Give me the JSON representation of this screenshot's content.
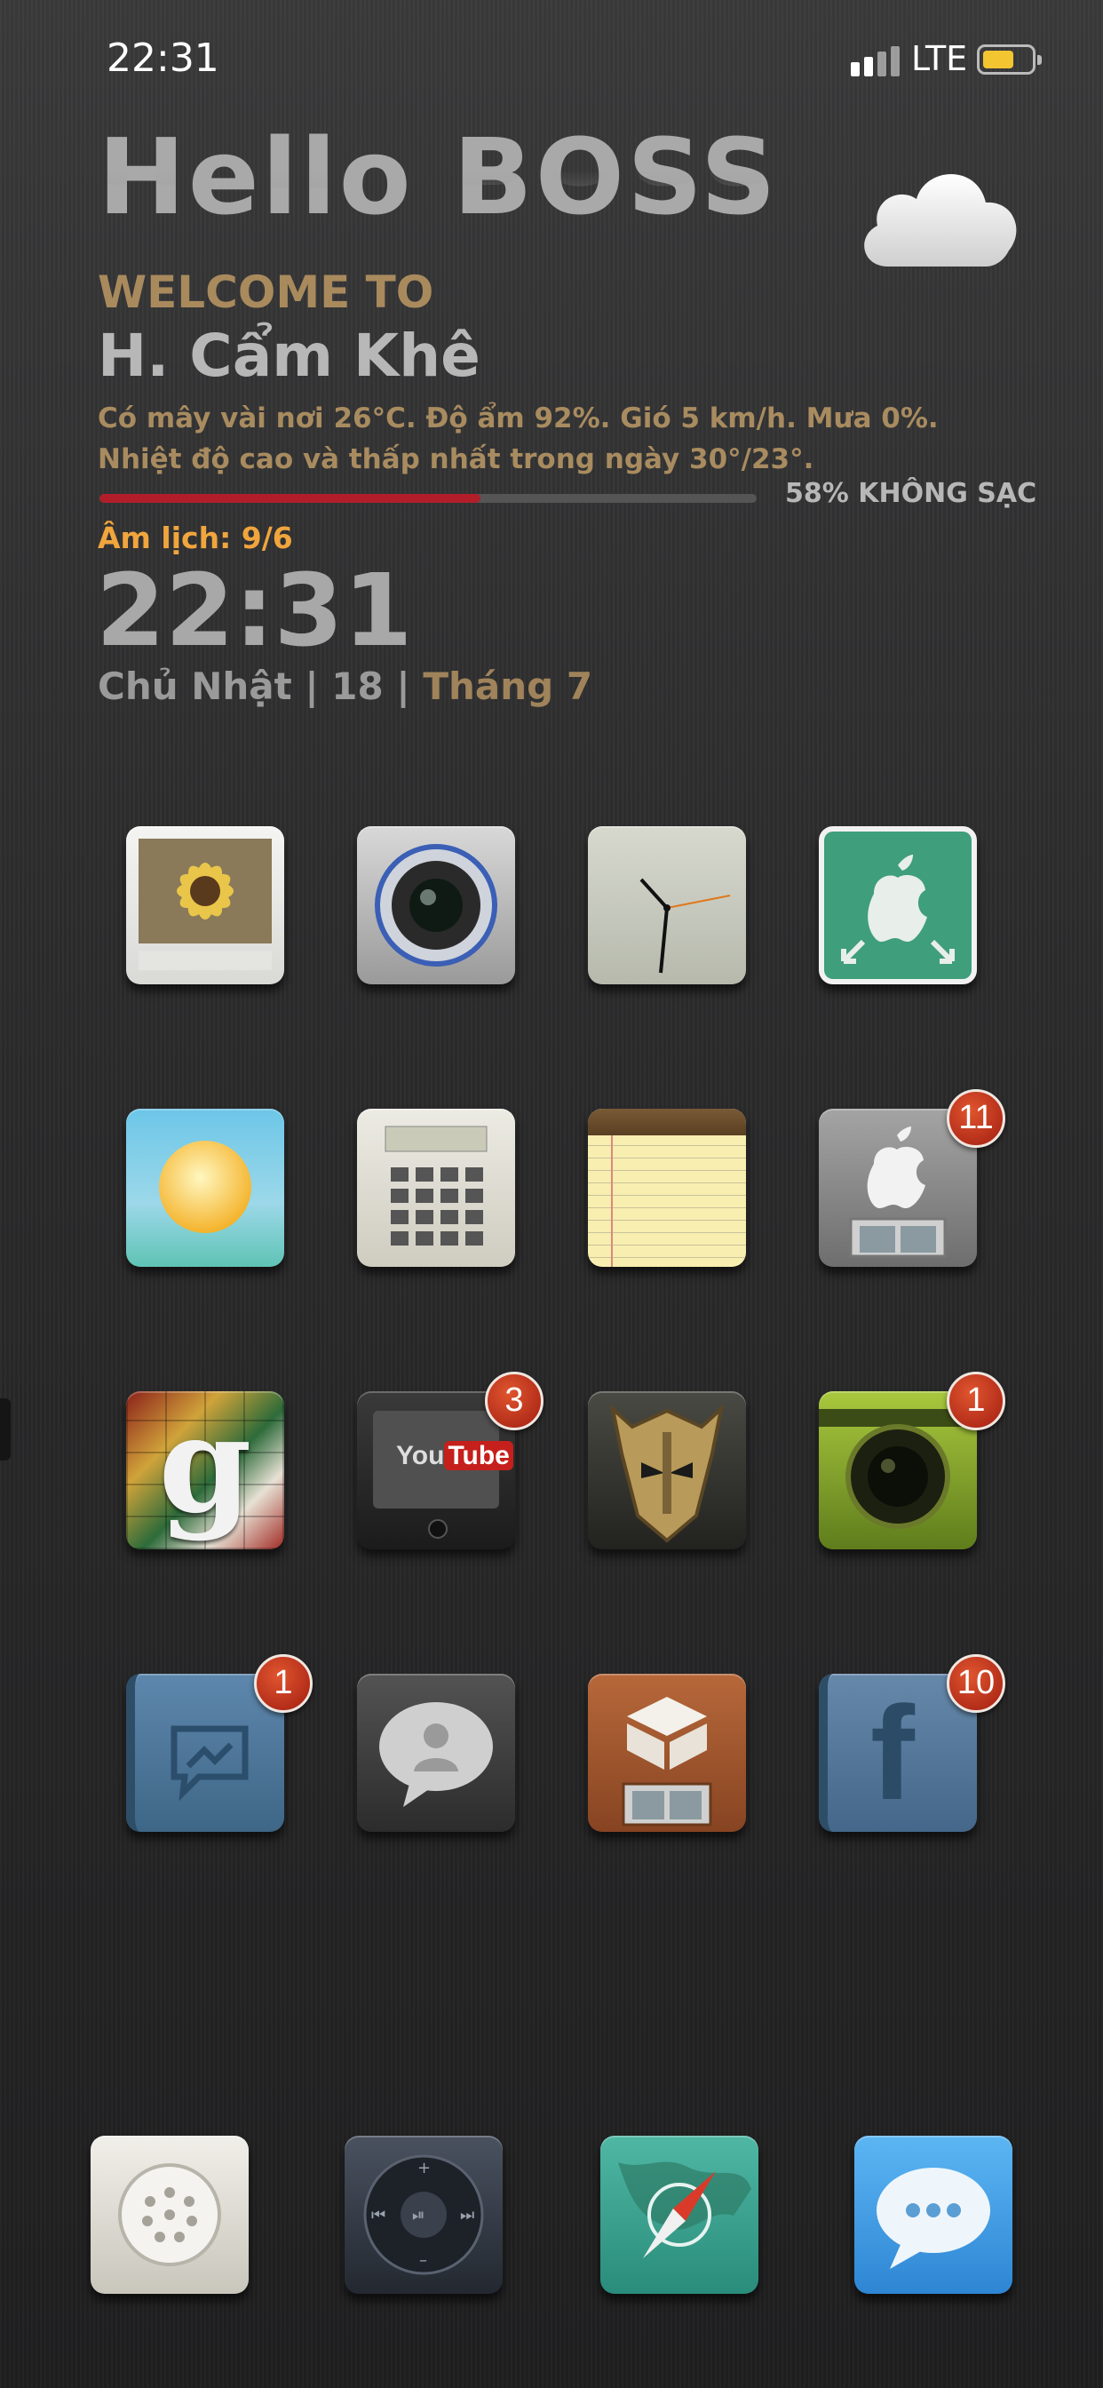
{
  "status_bar": {
    "time": "22:31",
    "network": "LTE",
    "battery_level": 0.58
  },
  "widget": {
    "greeting": "Hello BOSS",
    "welcome": "WELCOME TO",
    "location": "H. Cẩm Khê",
    "weather_text": "Có mây vài nơi 26°C. Độ ẩm 92%. Gió 5 km/h. Mưa 0%. Nhiệt độ cao và thấp nhất trong ngày 30°/23°.",
    "battery_percent": 58,
    "battery_text": "58% KHÔNG SẠC",
    "lunar_date": "Âm lịch: 9/6",
    "clock": "22:31",
    "day_part": "Chủ Nhật | 18 | ",
    "month_part": "Tháng 7",
    "weather_icon": "cloud-icon"
  },
  "apps": [
    {
      "icon": "photos-icon"
    },
    {
      "icon": "camera-icon"
    },
    {
      "icon": "clock-icon"
    },
    {
      "icon": "app-store-icon"
    },
    {
      "icon": "weather-icon"
    },
    {
      "icon": "calculator-icon"
    },
    {
      "icon": "notes-icon"
    },
    {
      "icon": "apple-store-icon",
      "badge": "11"
    },
    {
      "icon": "google-icon"
    },
    {
      "icon": "youtube-icon",
      "badge": "3",
      "label": "You",
      "label2": "Tube"
    },
    {
      "icon": "game-helmet-icon"
    },
    {
      "icon": "green-camera-icon",
      "badge": "1"
    },
    {
      "icon": "messenger-icon",
      "badge": "1"
    },
    {
      "icon": "contacts-icon"
    },
    {
      "icon": "cydia-icon"
    },
    {
      "icon": "facebook-icon",
      "badge": "10"
    }
  ],
  "dock": [
    {
      "icon": "phone-icon"
    },
    {
      "icon": "music-icon"
    },
    {
      "icon": "safari-icon"
    },
    {
      "icon": "messages-icon"
    }
  ]
}
